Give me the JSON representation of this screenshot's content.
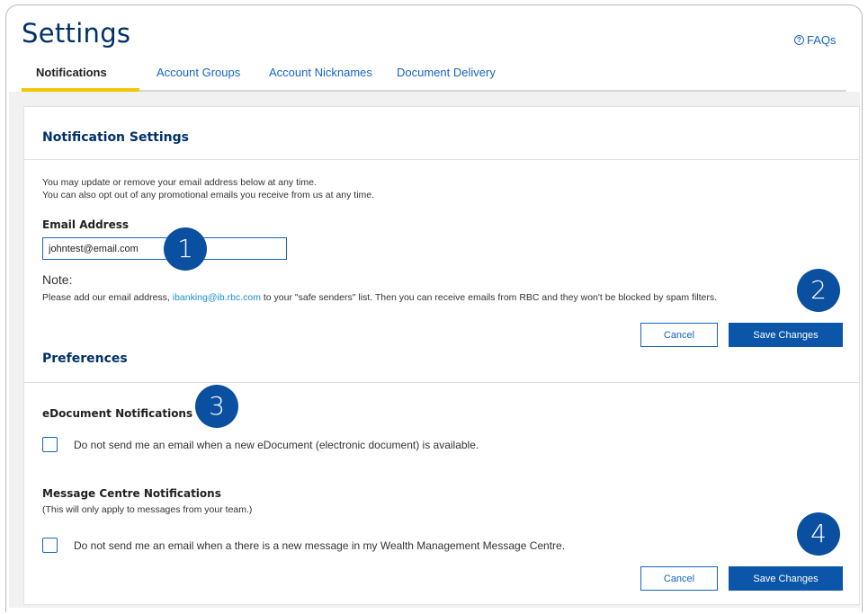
{
  "header": {
    "title": "Settings",
    "faq_label": "FAQs",
    "faq_icon": "question-circle-icon"
  },
  "tabs": [
    {
      "label": "Notifications",
      "active": true
    },
    {
      "label": "Account Groups",
      "active": false
    },
    {
      "label": "Account Nicknames",
      "active": false
    },
    {
      "label": "Document Delivery",
      "active": false
    }
  ],
  "notification_settings": {
    "title": "Notification Settings",
    "intro_line1": "You may update or remove your email address below at any time.",
    "intro_line2": "You can also opt out of any promotional emails you receive from us at any time.",
    "email_label": "Email Address",
    "email_value": "johntest@email.com",
    "note_label": "Note:",
    "note_text_before": "Please add our email address, ",
    "note_email": "ibanking@ib.rbc.com",
    "note_text_after": " to your \"safe senders\" list. Then you can receive emails from RBC and they won't be blocked by spam filters.",
    "cancel_label": "Cancel",
    "save_label": "Save Changes"
  },
  "preferences": {
    "title": "Preferences",
    "edocument": {
      "heading": "eDocument Notifications",
      "checkbox_label": "Do not send me an email when a new eDocument (electronic document) is available.",
      "checked": false
    },
    "message_centre": {
      "heading": "Message Centre Notifications",
      "subtext": "(This will only apply to messages from your team.)",
      "checkbox_label": "Do not send me an email when a there is a new message in my Wealth Management Message Centre.",
      "checked": false
    },
    "cancel_label": "Cancel",
    "save_label": "Save Changes"
  },
  "callouts": [
    "1",
    "2",
    "3",
    "4"
  ],
  "colors": {
    "brand_navy": "#003168",
    "link_blue": "#1565c0",
    "button_blue": "#0b56a8",
    "tab_accent": "#f7c600",
    "badge_blue": "#0b4fa0"
  }
}
